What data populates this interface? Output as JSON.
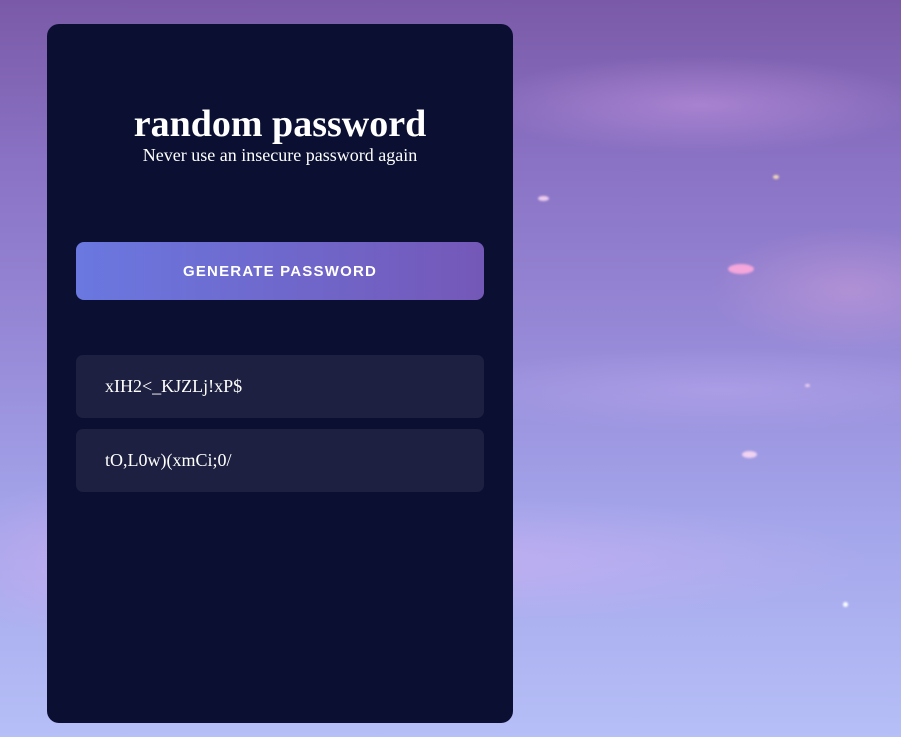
{
  "app": {
    "title": "random password",
    "subtitle": "Never use an insecure password again"
  },
  "generate_button": {
    "label": "GENERATE PASSWORD"
  },
  "passwords": [
    "xIH2<_KJZLj!xP$",
    "tO,L0w)(xmCi;0/"
  ],
  "colors": {
    "card_background": "#0b1033",
    "item_background": "#1d2040",
    "button_gradient_start": "#6a78e0",
    "button_gradient_end": "#7458b8",
    "text": "#ffffff"
  }
}
